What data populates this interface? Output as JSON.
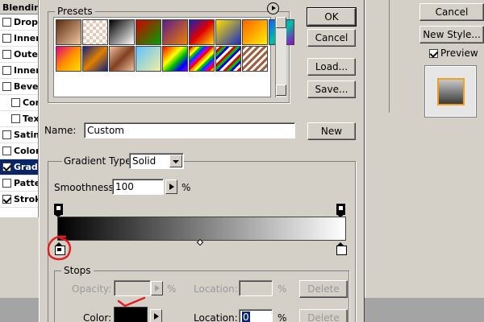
{
  "layer_style": {
    "title": "Blending",
    "items": [
      {
        "label": "Drop",
        "checked": false,
        "indent": false,
        "selected": false
      },
      {
        "label": "Inner",
        "checked": false,
        "indent": false,
        "selected": false
      },
      {
        "label": "Outer",
        "checked": false,
        "indent": false,
        "selected": false
      },
      {
        "label": "Inner",
        "checked": false,
        "indent": false,
        "selected": false
      },
      {
        "label": "Bevel",
        "checked": false,
        "indent": false,
        "selected": false
      },
      {
        "label": "Con",
        "checked": false,
        "indent": true,
        "selected": false
      },
      {
        "label": "Tex",
        "checked": false,
        "indent": true,
        "selected": false
      },
      {
        "label": "Satin",
        "checked": false,
        "indent": false,
        "selected": false
      },
      {
        "label": "Color",
        "checked": false,
        "indent": false,
        "selected": false
      },
      {
        "label": "Gradi",
        "checked": true,
        "indent": false,
        "selected": true
      },
      {
        "label": "Patte",
        "checked": false,
        "indent": false,
        "selected": false
      },
      {
        "label": "Strok",
        "checked": true,
        "indent": false,
        "selected": false
      }
    ],
    "cancel_label": "Cancel",
    "new_style_label": "New Style...",
    "preview_label": "Preview",
    "preview_checked": true
  },
  "gradient_editor": {
    "presets_legend": "Presets",
    "ok_label": "OK",
    "cancel_label": "Cancel",
    "load_label": "Load...",
    "save_label": "Save...",
    "name_label": "Name:",
    "name_value": "Custom",
    "new_label": "New",
    "gradient_type_label": "Gradient Type:",
    "gradient_type_value": "Solid",
    "smoothness_label": "Smoothness:",
    "smoothness_value": "100",
    "smoothness_unit": "%",
    "stops_legend": "Stops",
    "opacity_label": "Opacity:",
    "opacity_unit": "%",
    "opacity_location_label": "Location:",
    "opacity_location_unit": "%",
    "opacity_delete_label": "Delete",
    "color_label": "Color:",
    "color_location_label": "Location:",
    "color_location_value": "0",
    "color_location_unit": "%",
    "color_delete_label": "Delete",
    "stop_color": "#000000",
    "gradient_start_color": "#000000",
    "gradient_end_color": "#ffffff"
  },
  "presets": [
    "linear-gradient(135deg,#5a2a10,#f0c8a0)",
    "repeating-conic-gradient(#e8c8b0 0 25%,#ffffff 0 50%) 0 0/8px 8px",
    "linear-gradient(135deg,#000,#fff)",
    "linear-gradient(135deg,#d00000,#00a000)",
    "linear-gradient(135deg,#5a1a8a,#f08000)",
    "linear-gradient(135deg,#1020c0,#e00000,#ffe000)",
    "linear-gradient(135deg,#ffe000,#1830c0)",
    "linear-gradient(135deg,#ff6000,#fff000)",
    "linear-gradient(135deg,#1060ff,#00c0a0,#a000c0)",
    "linear-gradient(135deg,#e00080,#ff9000,#ffe000)",
    "linear-gradient(135deg,#102080,#e08000,#102080)",
    "linear-gradient(135deg,#f0c0a0,#804020,#f0c0a0)",
    "linear-gradient(135deg,#60c0ff,#f0f0a0)",
    "linear-gradient(135deg,#ff0000,#ff8000,#ffff00,#00c000,#0000ff,#8000ff)",
    "repeating-linear-gradient(135deg,#ff0000 0 3px,#ffa000 3px 6px,#ffff00 6px 9px,#00c000 9px 12px,#0040ff 12px 15px,#a000ff 15px 18px)",
    "repeating-linear-gradient(135deg,#ffffff 0 3px,#e00000 3px 6px,#00c000 6px 9px,#0000e0 9px 12px)",
    "repeating-linear-gradient(135deg,#a06040 0 3px,#ffffff 3px 6px)"
  ]
}
